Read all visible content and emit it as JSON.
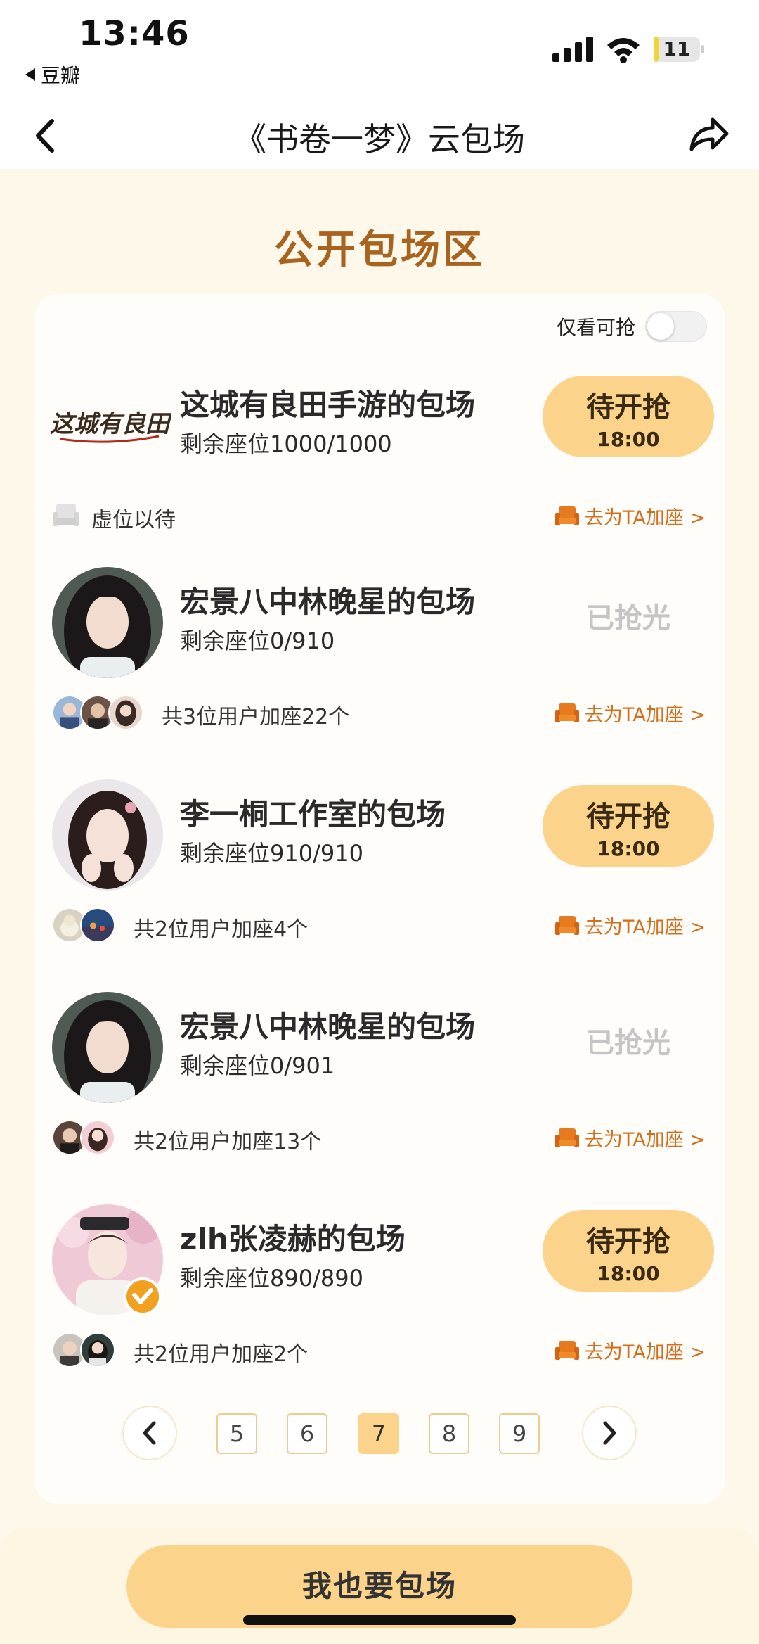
{
  "status_bar": {
    "time": "13:46",
    "back_app": "豆瓣",
    "battery": "11",
    "battery_level": 0.11
  },
  "nav": {
    "title": "《书卷一梦》云包场",
    "back_icon": "chevron-left-icon",
    "share_icon": "share-arrow-icon"
  },
  "section_title": "公开包场区",
  "filter": {
    "label": "仅看可抢",
    "enabled": false
  },
  "items": [
    {
      "title": "这城有良田手游的包场",
      "seats": "剩余座位1000/1000",
      "status": "待开抢",
      "time": "18:00",
      "logo_text": "这城有良田",
      "footer": "虚位以待",
      "join": "去为TA加座 >"
    },
    {
      "title": "宏景八中林晚星的包场",
      "seats": "剩余座位0/910",
      "status": "已抢光",
      "footer": "共3位用户加座22个",
      "join": "去为TA加座 >"
    },
    {
      "title": "李一桐工作室的包场",
      "seats": "剩余座位910/910",
      "status": "待开抢",
      "time": "18:00",
      "footer": "共2位用户加座4个",
      "join": "去为TA加座 >"
    },
    {
      "title": "宏景八中林晚星的包场",
      "seats": "剩余座位0/901",
      "status": "已抢光",
      "footer": "共2位用户加座13个",
      "join": "去为TA加座 >"
    },
    {
      "title": "zlh张凌赫的包场",
      "seats": "剩余座位890/890",
      "status": "待开抢",
      "time": "18:00",
      "footer": "共2位用户加座2个",
      "join": "去为TA加座 >"
    }
  ],
  "pagination": {
    "pages": [
      "5",
      "6",
      "7",
      "8",
      "9"
    ],
    "current": "7"
  },
  "cta": {
    "label": "我也要包场"
  },
  "colors": {
    "accent": "#fcd38b",
    "heading": "#a8631f",
    "link": "#d36f1c",
    "sold_out": "#c5c5c5",
    "background": "#fdf8ea"
  }
}
